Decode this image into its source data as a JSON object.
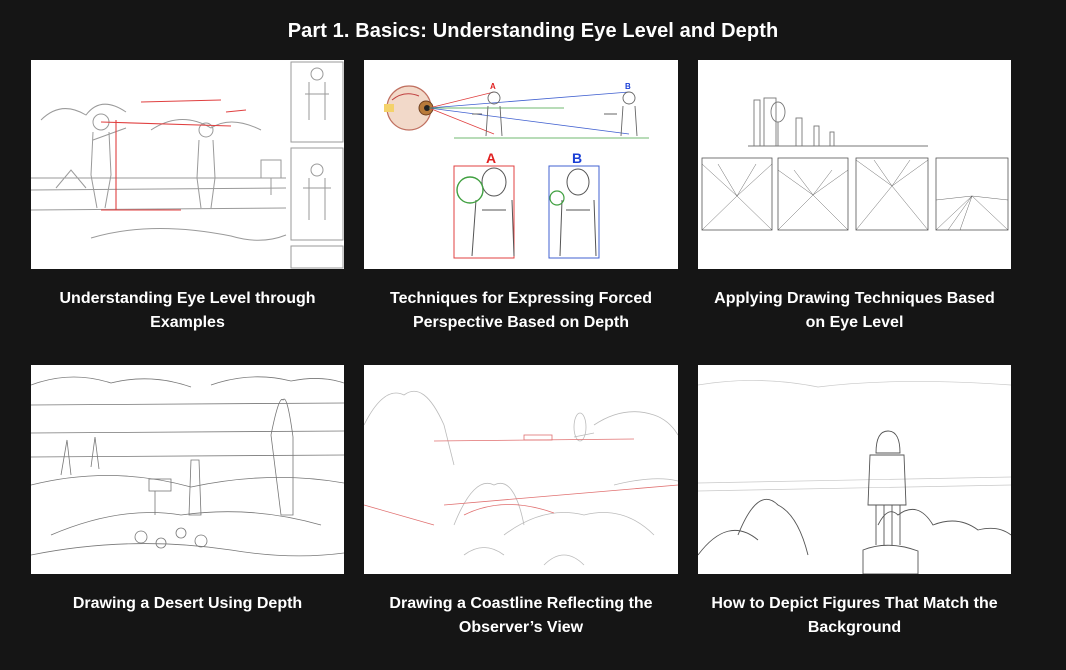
{
  "header": {
    "title": "Part 1. Basics: Understanding Eye Level and Depth"
  },
  "lessons": [
    {
      "caption": "Understanding Eye Level through Examples"
    },
    {
      "caption": "Techniques for Expressing Forced Perspective Based on Depth",
      "labels": [
        "A",
        "B",
        "A",
        "B"
      ]
    },
    {
      "caption": "Applying Drawing Techniques Based on Eye Level"
    },
    {
      "caption": "Drawing a Desert Using Depth"
    },
    {
      "caption": "Drawing a Coastline Reflecting the Observer’s View"
    },
    {
      "caption": "How to Depict Figures That Match the Background"
    }
  ],
  "colors": {
    "background": "#151515",
    "label_a": "#e02020",
    "label_b": "#1a3fd6"
  }
}
